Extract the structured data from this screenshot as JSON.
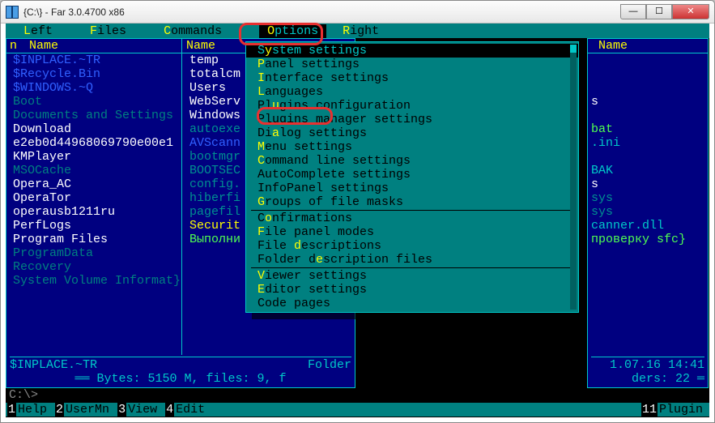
{
  "window": {
    "title": "{C:\\} - Far 3.0.4700 x86"
  },
  "menubar": [
    {
      "hk": "L",
      "rest": "eft"
    },
    {
      "hk": "F",
      "rest": "iles"
    },
    {
      "hk": "C",
      "rest": "ommands"
    },
    {
      "hk": "O",
      "rest": "ptions"
    },
    {
      "hk": "R",
      "rest": "ight"
    }
  ],
  "menubar_active_index": 3,
  "left_panel": {
    "header": {
      "n": "n",
      "name": "Name",
      "name2": "Name"
    },
    "col1": [
      {
        "t": "$INPLACE.~TR",
        "c": "lblue"
      },
      {
        "t": "$Recycle.Bin",
        "c": "lblue"
      },
      {
        "t": "$WINDOWS.~Q",
        "c": "lblue"
      },
      {
        "t": "Boot",
        "c": "teal"
      },
      {
        "t": "Documents and Settings",
        "c": "teal"
      },
      {
        "t": "Download",
        "c": "white"
      },
      {
        "t": "e2eb0d44968069790e00e1",
        "c": "white"
      },
      {
        "t": "KMPlayer",
        "c": "white"
      },
      {
        "t": "MSOCache",
        "c": "teal"
      },
      {
        "t": "Opera_AC",
        "c": "white"
      },
      {
        "t": "OperaTor",
        "c": "white"
      },
      {
        "t": "operausb1211ru",
        "c": "white"
      },
      {
        "t": "PerfLogs",
        "c": "white"
      },
      {
        "t": "Program Files",
        "c": "white"
      },
      {
        "t": "ProgramData",
        "c": "teal"
      },
      {
        "t": "Recovery",
        "c": "teal"
      },
      {
        "t": "System Volume Informat}",
        "c": "teal"
      }
    ],
    "col2": [
      {
        "t": "temp",
        "c": "white"
      },
      {
        "t": "totalcm",
        "c": "white"
      },
      {
        "t": "Users",
        "c": "white"
      },
      {
        "t": "WebServ",
        "c": "white"
      },
      {
        "t": "Windows",
        "c": "white"
      },
      {
        "t": "autoexe",
        "c": "tealtxt"
      },
      {
        "t": "AVScann",
        "c": "lblue"
      },
      {
        "t": "bootmgr",
        "c": "tealtxt"
      },
      {
        "t": "BOOTSEC",
        "c": "tealtxt"
      },
      {
        "t": "config.",
        "c": "tealtxt"
      },
      {
        "t": "hiberfi",
        "c": "tealtxt"
      },
      {
        "t": "pagefil",
        "c": "tealtxt"
      },
      {
        "t": "Securit",
        "c": "yellow"
      },
      {
        "t": "Выполни",
        "c": "brgreen"
      }
    ],
    "footer_sel": "$INPLACE.~TR",
    "footer_type": "Folder",
    "footer_stats": "Bytes: 5150 M, files: 9, f"
  },
  "right_panel": {
    "header_name": "Name",
    "items": [
      {
        "t": "s",
        "c": "white"
      },
      {
        "t": "",
        "c": ""
      },
      {
        "t": "bat",
        "c": "brgreen"
      },
      {
        "t": ".ini",
        "c": "tcyan"
      },
      {
        "t": "",
        "c": ""
      },
      {
        "t": "BAK",
        "c": "tcyan"
      },
      {
        "t": "s",
        "c": "white"
      },
      {
        "t": "sys",
        "c": "tealtxt"
      },
      {
        "t": "sys",
        "c": "tealtxt"
      },
      {
        "t": "canner.dll",
        "c": "tcyan"
      },
      {
        "t": "проверку sfc}",
        "c": "brgreen"
      }
    ],
    "footer_time": "1.07.16 14:41",
    "footer_ders": "ders: 22"
  },
  "dropdown": {
    "groups": [
      [
        {
          "pre": "S",
          "hk": "y",
          "post": "stem settings",
          "sel": true
        },
        {
          "pre": "",
          "hk": "P",
          "post": "anel settings"
        },
        {
          "pre": "",
          "hk": "I",
          "post": "nterface settings"
        },
        {
          "pre": "",
          "hk": "L",
          "post": "anguages",
          "highlight": true
        },
        {
          "pre": "Pl",
          "hk": "u",
          "post": "gins configuration"
        },
        {
          "pre": "Plugins manager settings",
          "hk": "",
          "post": ""
        },
        {
          "pre": "Di",
          "hk": "a",
          "post": "log settings"
        },
        {
          "pre": "",
          "hk": "M",
          "post": "enu settings"
        },
        {
          "pre": "",
          "hk": "C",
          "post": "ommand line settings"
        },
        {
          "pre": "AutoComplete settings",
          "hk": "",
          "post": ""
        },
        {
          "pre": "InfoPanel settings",
          "hk": "",
          "post": ""
        },
        {
          "pre": "",
          "hk": "G",
          "post": "roups of file masks"
        }
      ],
      [
        {
          "pre": "C",
          "hk": "o",
          "post": "nfirmations"
        },
        {
          "pre": "",
          "hk": "F",
          "post": "ile panel modes"
        },
        {
          "pre": "File ",
          "hk": "d",
          "post": "escriptions"
        },
        {
          "pre": "Folder d",
          "hk": "e",
          "post": "scription files"
        }
      ],
      [
        {
          "pre": "",
          "hk": "V",
          "post": "iewer settings"
        },
        {
          "pre": "",
          "hk": "E",
          "post": "ditor settings"
        },
        {
          "pre": "Code pages",
          "hk": "",
          "post": ""
        }
      ]
    ]
  },
  "cmdline": "C:\\>",
  "keybar": [
    {
      "n": "1",
      "lbl": "Help"
    },
    {
      "n": "2",
      "lbl": "UserMn"
    },
    {
      "n": "3",
      "lbl": "View"
    },
    {
      "n": "4",
      "lbl": "Edit"
    },
    {
      "n": "11",
      "lbl": "Plugin"
    }
  ]
}
